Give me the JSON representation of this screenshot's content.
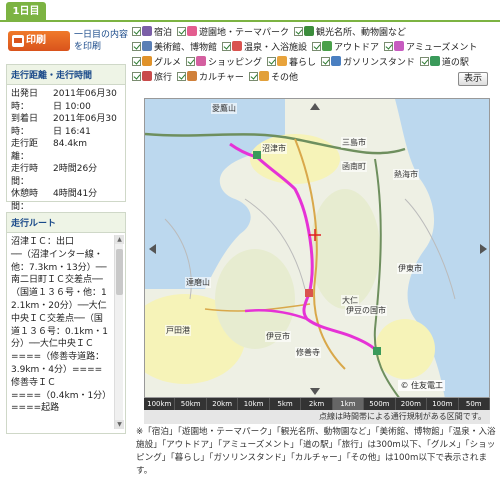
{
  "tab": {
    "label": "1日目"
  },
  "print": {
    "button_label": "印刷",
    "description": "一日目の内容を印刷"
  },
  "summary": {
    "heading": "走行距離・走行時間",
    "rows": [
      {
        "key": "出発日時：",
        "value": "2011年06月30日 10:00"
      },
      {
        "key": "到着日時：",
        "value": "2011年06月30日 16:41"
      },
      {
        "key": "走行距離：",
        "value": "84.4km"
      },
      {
        "key": "走行時間：",
        "value": "2時間26分"
      },
      {
        "key": "休憩時間：",
        "value": "4時間41分"
      }
    ]
  },
  "route": {
    "heading": "走行ルート",
    "text": "沼津ＩＣ：出口\n──（沼津インター線・他：7.3km・13分）──南二日町ＩＣ交差点──（国道１３６号・他：12.1km・20分）──大仁中央ＩＣ交差点──（国道１３６号：0.1km・1分）──大仁中央ＩＣ\n====（修善寺道路：3.9km・4分）====修善寺ＩＣ\n====（0.4km・1分）====起路"
  },
  "legend": {
    "items": [
      {
        "label": "宿泊",
        "icon_color": "#7b5ea7"
      },
      {
        "label": "遊園地・テーマパーク",
        "icon_color": "#e35d8f"
      },
      {
        "label": "観光名所、動物園など",
        "icon_color": "#3c8d3c"
      },
      {
        "label": "美術館、博物館",
        "icon_color": "#5a7fb5"
      },
      {
        "label": "温泉・入浴施設",
        "icon_color": "#d9534f"
      },
      {
        "label": "アウトドア",
        "icon_color": "#4aa04a"
      },
      {
        "label": "アミューズメント",
        "icon_color": "#c75bc0"
      },
      {
        "label": "グルメ",
        "icon_color": "#e0922a"
      },
      {
        "label": "ショッピング",
        "icon_color": "#d45fa0"
      },
      {
        "label": "暮らし",
        "icon_color": "#e8a33c"
      },
      {
        "label": "ガソリンスタンド",
        "icon_color": "#4a7fc1"
      },
      {
        "label": "道の駅",
        "icon_color": "#3a9a5a"
      },
      {
        "label": "旅行",
        "icon_color": "#c94b4b"
      },
      {
        "label": "カルチャー",
        "icon_color": "#d0803a"
      },
      {
        "label": "その他",
        "icon_color": "#e2a03a"
      }
    ],
    "show_button": "表示"
  },
  "map": {
    "place_labels": [
      "愛鷹山",
      "沼津市",
      "三島市",
      "函南町",
      "伊豆の国市",
      "熱海市",
      "伊東市",
      "伊豆市",
      "達磨山",
      "戸田港",
      "大仁",
      "修善寺"
    ],
    "copyright": "© 住友電工",
    "scales": [
      "100km",
      "50km",
      "20km",
      "10km",
      "5km",
      "2km",
      "1km",
      "500m",
      "200m",
      "100m",
      "50m"
    ],
    "active_scale": "1km",
    "route_color": "#e632d6"
  },
  "note": "点線は時間帯による通行規制がある区間です。",
  "footer": "※「宿泊」「遊園地・テーマパーク」「観光名所、動物園など」「美術館、博物館」「温泉・入浴施設」「アウトドア」「アミューズメント」「道の駅」「旅行」は300m以下、「グルメ」「ショッピング」「暮らし」「ガソリンスタンド」「カルチャー」「その他」は100m以下で表示されます。"
}
